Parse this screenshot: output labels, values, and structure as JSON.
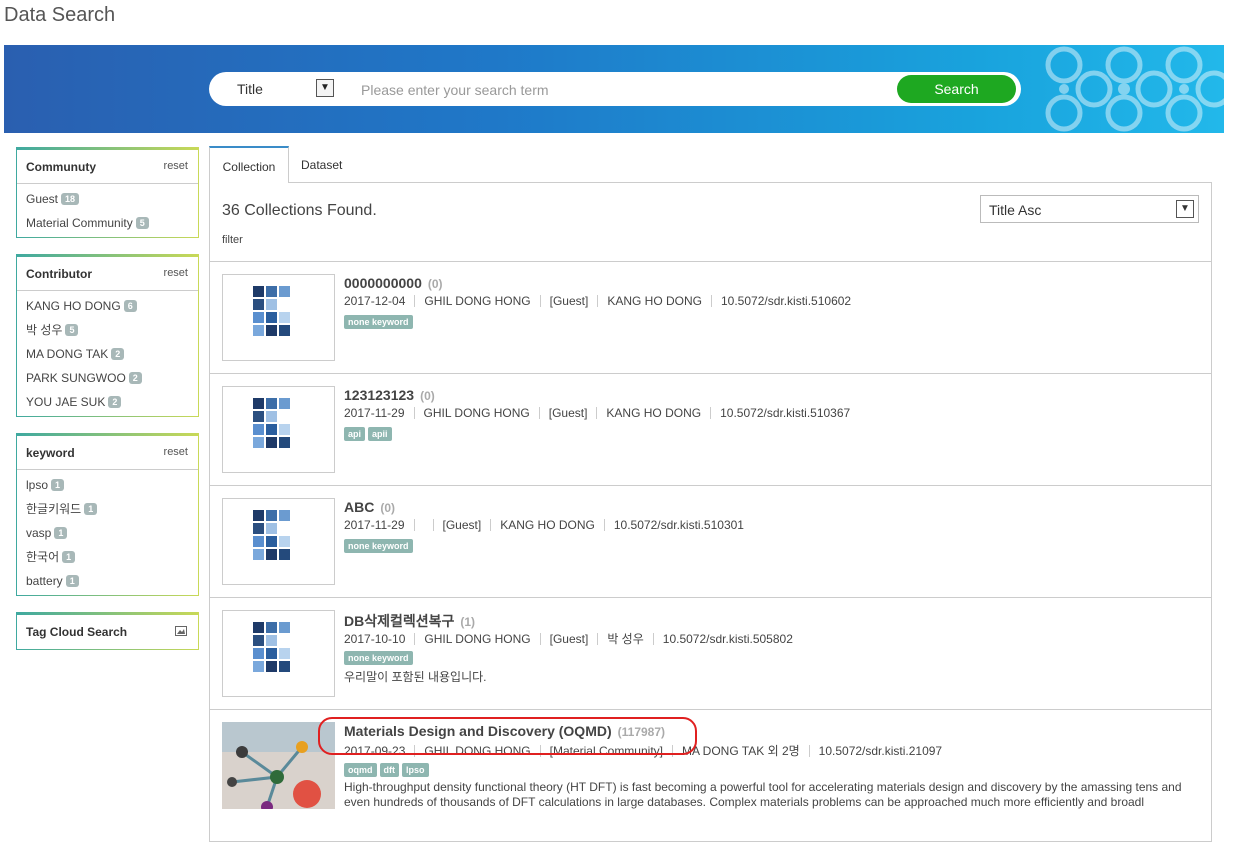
{
  "page_title": "Data Search",
  "search": {
    "select_label": "Title",
    "placeholder": "Please enter your search term",
    "button_label": "Search"
  },
  "facets": {
    "community": {
      "title": "Communuty",
      "reset": "reset",
      "items": [
        {
          "label": "Guest",
          "count": "18"
        },
        {
          "label": "Material Community",
          "count": "5"
        }
      ]
    },
    "contributor": {
      "title": "Contributor",
      "reset": "reset",
      "items": [
        {
          "label": "KANG HO DONG",
          "count": "6"
        },
        {
          "label": "박 성우",
          "count": "5"
        },
        {
          "label": "MA DONG TAK",
          "count": "2"
        },
        {
          "label": "PARK SUNGWOO",
          "count": "2"
        },
        {
          "label": "YOU JAE SUK",
          "count": "2"
        }
      ]
    },
    "keyword": {
      "title": "keyword",
      "reset": "reset",
      "items": [
        {
          "label": "lpso",
          "count": "1"
        },
        {
          "label": "한글키워드",
          "count": "1"
        },
        {
          "label": "vasp",
          "count": "1"
        },
        {
          "label": "한국어",
          "count": "1"
        },
        {
          "label": "battery",
          "count": "1"
        }
      ]
    },
    "tagcloud": {
      "title": "Tag Cloud Search",
      "icon": "image-icon"
    }
  },
  "tabs": [
    {
      "label": "Collection",
      "active": true
    },
    {
      "label": "Dataset",
      "active": false
    }
  ],
  "results_header": {
    "found": "36 Collections Found.",
    "filter": "filter",
    "sort": "Title Asc"
  },
  "results": [
    {
      "title": "0000000000",
      "count": "(0)",
      "date": "2017-12-04",
      "creator": "GHIL DONG HONG",
      "community": "[Guest]",
      "contributor": "KANG HO DONG",
      "doi": "10.5072/sdr.kisti.510602",
      "tags": [
        "none keyword"
      ],
      "description": ""
    },
    {
      "title": "123123123",
      "count": "(0)",
      "date": "2017-11-29",
      "creator": "GHIL DONG HONG",
      "community": "[Guest]",
      "contributor": "KANG HO DONG",
      "doi": "10.5072/sdr.kisti.510367",
      "tags": [
        "api",
        "apii"
      ],
      "description": ""
    },
    {
      "title": "ABC",
      "count": "(0)",
      "date": "2017-11-29",
      "creator": "",
      "community": "[Guest]",
      "contributor": "KANG HO DONG",
      "doi": "10.5072/sdr.kisti.510301",
      "tags": [
        "none keyword"
      ],
      "description": ""
    },
    {
      "title": "DB삭제컬렉션복구",
      "count": "(1)",
      "date": "2017-10-10",
      "creator": "GHIL DONG HONG",
      "community": "[Guest]",
      "contributor": "박 성우",
      "doi": "10.5072/sdr.kisti.505802",
      "tags": [
        "none keyword"
      ],
      "description": "우리말이 포함된 내용입니다."
    },
    {
      "title": "Materials Design and Discovery (OQMD)",
      "count": "(117987)",
      "date": "2017-09-23",
      "creator": "GHIL DONG HONG",
      "community": "[Material Community]",
      "contributor": "MA DONG TAK 외 2명",
      "doi": "10.5072/sdr.kisti.21097",
      "tags": [
        "oqmd",
        "dft",
        "lpso"
      ],
      "description": "High-throughput density functional theory (HT DFT) is fast becoming a powerful tool for accelerating materials design and discovery by the amassing tens and even hundreds of thousands of DFT calculations in large databases. Complex materials problems can be approached much more efficiently and broadl"
    }
  ],
  "colors": {
    "accent_green": "#1ea821",
    "tag_bg": "#8eb6b0",
    "highlight": "#e02020",
    "tab_top": "#3a8cc8"
  }
}
